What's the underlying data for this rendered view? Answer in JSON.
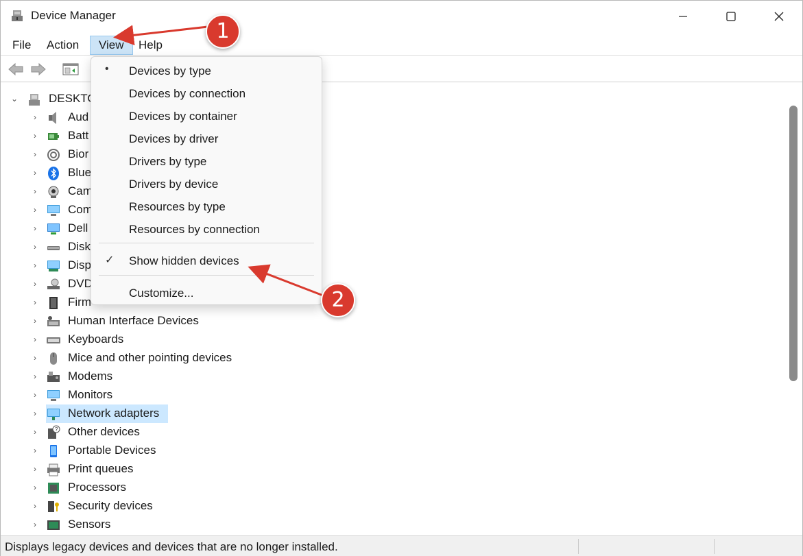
{
  "window": {
    "title": "Device Manager",
    "min_icon": "minimize-icon",
    "max_icon": "maximize-icon",
    "close_icon": "close-icon"
  },
  "menu": {
    "file": "File",
    "action": "Action",
    "view": "View",
    "help": "Help"
  },
  "toolbar": {
    "icons": [
      "back-arrow-icon",
      "forward-arrow-icon",
      "properties-icon"
    ]
  },
  "tree": {
    "root": "DESKTO",
    "items": [
      {
        "label": "Aud",
        "icon": "audio-icon"
      },
      {
        "label": "Batt",
        "icon": "battery-icon"
      },
      {
        "label": "Bior",
        "icon": "biometric-icon"
      },
      {
        "label": "Blue",
        "icon": "bluetooth-icon"
      },
      {
        "label": "Cam",
        "icon": "camera-icon"
      },
      {
        "label": "Com",
        "icon": "computer-icon"
      },
      {
        "label": "Dell",
        "icon": "dell-icon"
      },
      {
        "label": "Disk",
        "icon": "disk-drive-icon"
      },
      {
        "label": "Disp",
        "icon": "display-adapter-icon"
      },
      {
        "label": "DVD",
        "icon": "dvd-drive-icon"
      },
      {
        "label": "Firm",
        "icon": "firmware-icon"
      },
      {
        "label": "Human Interface Devices",
        "icon": "hid-icon"
      },
      {
        "label": "Keyboards",
        "icon": "keyboard-icon"
      },
      {
        "label": "Mice and other pointing devices",
        "icon": "mouse-icon"
      },
      {
        "label": "Modems",
        "icon": "modem-icon"
      },
      {
        "label": "Monitors",
        "icon": "monitor-icon"
      },
      {
        "label": "Network adapters",
        "icon": "network-adapter-icon"
      },
      {
        "label": "Other devices",
        "icon": "other-devices-icon"
      },
      {
        "label": "Portable Devices",
        "icon": "portable-device-icon"
      },
      {
        "label": "Print queues",
        "icon": "printer-icon"
      },
      {
        "label": "Processors",
        "icon": "processor-icon"
      },
      {
        "label": "Security devices",
        "icon": "security-device-icon"
      },
      {
        "label": "Sensors",
        "icon": "sensor-icon"
      }
    ],
    "selected": "Network adapters"
  },
  "view_menu": {
    "items": [
      {
        "label": "Devices by type",
        "mark": "•"
      },
      {
        "label": "Devices by connection",
        "mark": ""
      },
      {
        "label": "Devices by container",
        "mark": ""
      },
      {
        "label": "Devices by driver",
        "mark": ""
      },
      {
        "label": "Drivers by type",
        "mark": ""
      },
      {
        "label": "Drivers by device",
        "mark": ""
      },
      {
        "label": "Resources by type",
        "mark": ""
      },
      {
        "label": "Resources by connection",
        "mark": ""
      }
    ],
    "show_hidden": {
      "label": "Show hidden devices",
      "mark": "✓"
    },
    "customize": "Customize..."
  },
  "annotations": {
    "step1": "1",
    "step2": "2",
    "color": "#d93a2e"
  },
  "status": {
    "text": "Displays legacy devices and devices that are no longer installed."
  }
}
